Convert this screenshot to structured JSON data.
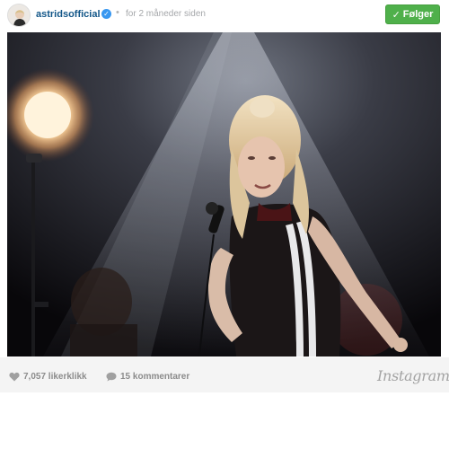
{
  "post": {
    "username": "astridsofficial",
    "verified_glyph": "✓",
    "separator": "•",
    "timestamp": "for 2 måneder siden",
    "follow": {
      "check_glyph": "✓",
      "label": "Følger"
    },
    "likes": {
      "icon": "heart-icon",
      "count_text": "7,057 likerklikk"
    },
    "comments": {
      "icon": "speech-bubble-icon",
      "count_text": "15 kommentarer"
    },
    "brand": "Instagram"
  },
  "colors": {
    "username": "#125688",
    "verified": "#3897f0",
    "follow_button": "#4fb04b",
    "footer_bg": "#f4f4f4",
    "footer_text": "#8c8c8c"
  }
}
